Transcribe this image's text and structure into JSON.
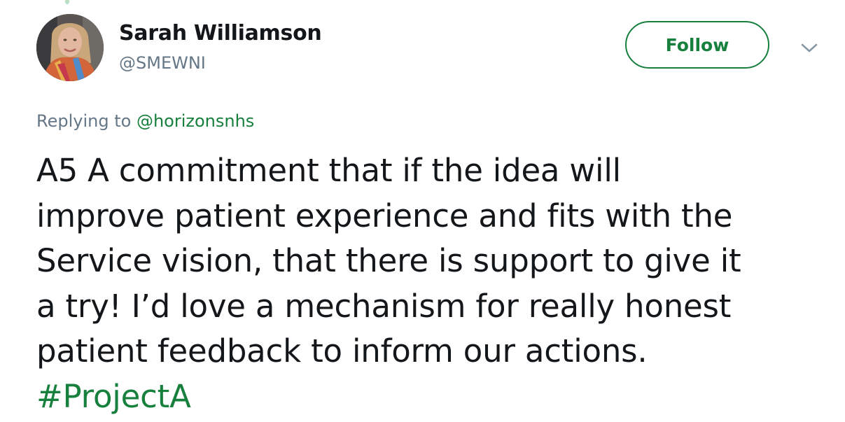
{
  "colors": {
    "accent_green": "#17803d",
    "secondary_text": "#657786",
    "primary_text": "#14171a",
    "thread_line": "#b9e0c4"
  },
  "user": {
    "display_name": "Sarah Williamson",
    "handle": "@SMEWNI",
    "avatar_icon": "profile-photo"
  },
  "follow_button": {
    "label": "Follow"
  },
  "menu": {
    "icon": "chevron-down-icon"
  },
  "reply": {
    "prefix": "Replying to",
    "mention": "@horizonsnhs"
  },
  "tweet": {
    "lines": [
      "A5 A commitment that if the idea will",
      "improve patient experience and fits with the",
      "Service vision, that there is support to give it",
      "a try! I’d love a mechanism for really honest",
      "patient feedback to inform our actions."
    ],
    "hashtag": "#ProjectA"
  }
}
